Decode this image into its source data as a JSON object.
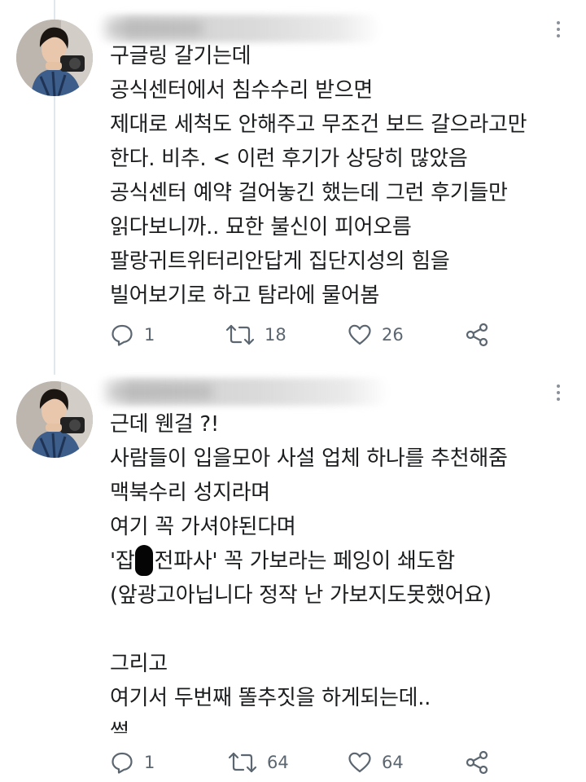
{
  "tweets": [
    {
      "lines": [
        "구글링 갈기는데",
        "공식센터에서 침수수리 받으면",
        "제대로 세척도 안해주고 무조건 보드 갈으라고만",
        "한다. 비추. < 이런 후기가 상당히 많았음",
        "공식센터 예약 걸어놓긴 했는데 그런 후기들만",
        "읽다보니까.. 묘한 불신이 피어오름",
        "팔랑귀트위터리안답게 집단지성의 힘을",
        "빌어보기로 하고 탐라에 물어봄"
      ],
      "stats": {
        "replies": "1",
        "retweets": "18",
        "likes": "26"
      }
    },
    {
      "lines": [
        "근데 웬걸 ?!",
        "사람들이 입을모아 사설 업체 하나를 추천해줌",
        "맥북수리 성지라며",
        "여기 꼭 가셔야된다며",
        "",
        "(앞광고아닙니다 정작 난 가보지도못했어요)",
        "",
        "그리고",
        "여기서 두번째 똘추짓을 하게되는데..",
        "썰"
      ],
      "redacted_line": {
        "before": "'잡",
        "after": "전파사' 꼭 가보라는 페잉이 쇄도함"
      },
      "stats": {
        "replies": "1",
        "retweets": "64",
        "likes": "64"
      }
    }
  ],
  "icons": {
    "reply": "reply-icon",
    "retweet": "retweet-icon",
    "like": "heart-icon",
    "share": "share-icon",
    "more": "more-icon"
  },
  "colors": {
    "text": "#1b1d1f",
    "icon": "#5b6670",
    "thread_line": "#e1e8ed"
  }
}
